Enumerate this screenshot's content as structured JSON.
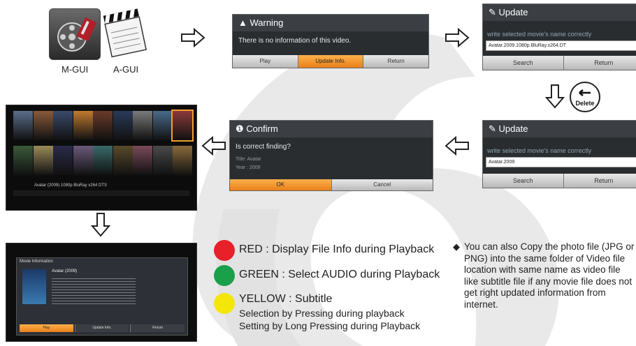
{
  "icons": {
    "mgui_caption": "M-GUI",
    "agui_caption": "A-GUI",
    "mgui_icon": "film-reel-icon",
    "agui_icon": "clapperboard-icon"
  },
  "warning_dialog": {
    "title": "Warning",
    "message": "There is no information of this video.",
    "buttons": [
      "Play",
      "Update Info.",
      "Return"
    ],
    "selected_button": 1
  },
  "update_dialog_1": {
    "title": "Update",
    "hint": "write selected movie's name correctly",
    "field_value": "Avatar.2009.1080p.BluRay.x264.DT",
    "buttons": [
      "Search",
      "Return"
    ]
  },
  "update_dialog_2": {
    "title": "Update",
    "hint": "write selected movie's name correctly",
    "field_value": "Avatar.2009",
    "buttons": [
      "Search",
      "Return"
    ]
  },
  "delete_key": {
    "label": "Delete",
    "icon": "back-arrow-icon"
  },
  "confirm_dialog": {
    "title": "Confirm",
    "message": "Is correct finding?",
    "line1": "Title: Avatar",
    "line2": "Year : 2009",
    "buttons": [
      "OK",
      "Cancel"
    ],
    "selected_button": 0
  },
  "grid_screen": {
    "caption": "Avatar (2009) 1080p BluRay x264 DTS",
    "poster_colors": [
      "#5a6e8a",
      "#8a5a3a",
      "#3a4a6a",
      "#c07a30",
      "#6a3a2a",
      "#2a3a5a",
      "#7a7a7a",
      "#4a6a8a",
      "#8a3a3a",
      "#3a5a3a",
      "#9a8a5a",
      "#2a2a4a",
      "#6a5a7a",
      "#3a6a6a",
      "#5a4a2a",
      "#7a4a5a",
      "#4a4a4a",
      "#8a6a3a"
    ]
  },
  "info_screen": {
    "title": "Movie Information",
    "movie": "Avatar (2009)",
    "buttons": [
      "Play",
      "Update Info.",
      "Return"
    ]
  },
  "legend": {
    "red": {
      "color": "#e8202a",
      "label": "RED : Display File Info during Playback"
    },
    "green": {
      "color": "#1aa04a",
      "label": "GREEN : Select AUDIO during Playback"
    },
    "yellow": {
      "color": "#f5e60a",
      "label": "YELLOW : Subtitle",
      "line2": "Selection by Pressing during playback",
      "line3": "Setting by Long Pressing during Playback"
    }
  },
  "note": {
    "bullet": "◆",
    "text": "You can also Copy the photo file (JPG or PNG) into the same folder of Video file location with same name as video file like subtitle file if any movie file does not get right updated information from internet."
  }
}
